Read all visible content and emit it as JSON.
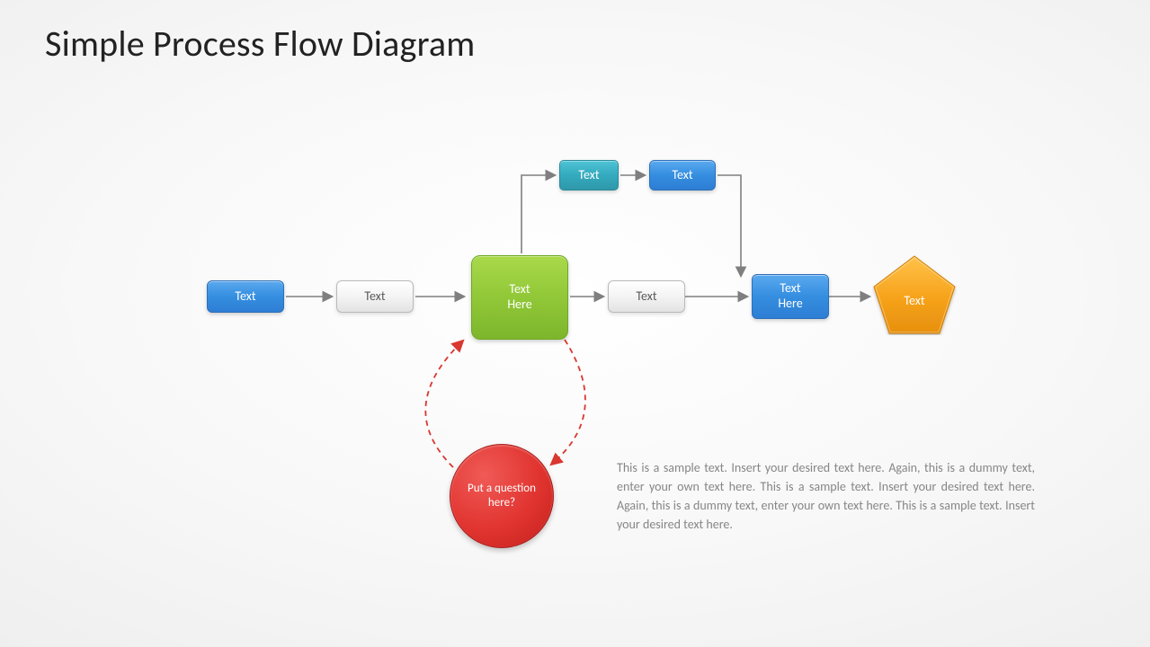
{
  "title": "Simple Process Flow Diagram",
  "nodes": {
    "n1": "Text",
    "n2": "Text",
    "n3": "Text\nHere",
    "n4": "Text",
    "n5": "Text\nHere",
    "n6": "Text",
    "top1": "Text",
    "top2": "Text",
    "circle": "Put a question here?"
  },
  "description": "This is a sample text. Insert your desired text here. Again, this is a dummy text, enter your own text here. This is a sample text. Insert your desired text here. Again, this is a dummy text, enter your own text here. This is a sample text. Insert your desired text here."
}
